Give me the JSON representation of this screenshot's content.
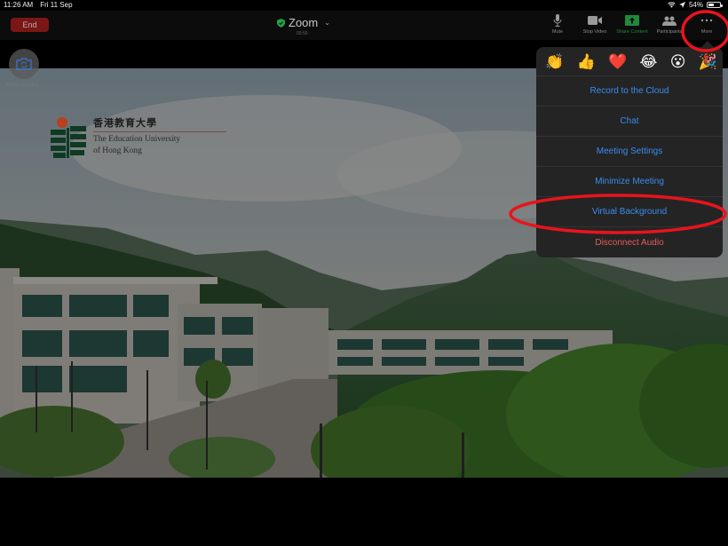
{
  "status_bar": {
    "time": "11:26 AM",
    "date": "Fri 11 Sep",
    "battery_percent_label": "54%",
    "battery_level": 0.54
  },
  "toolbar": {
    "end_label": "End",
    "meeting_name": "Zoom",
    "meeting_timer": "00:50",
    "buttons": [
      {
        "label": "Mute",
        "icon": "microphone-icon"
      },
      {
        "label": "Stop Video",
        "icon": "video-camera-icon"
      },
      {
        "label": "Share Content",
        "icon": "share-screen-icon"
      },
      {
        "label": "Participants",
        "icon": "participants-icon"
      },
      {
        "label": "More",
        "icon": "more-dots-icon"
      }
    ]
  },
  "video": {
    "switch_camera_label": "Switch Camera",
    "logo": {
      "chinese": "香港教育大學",
      "english_line1": "The Education University",
      "english_line2": "of Hong Kong"
    }
  },
  "more_menu": {
    "reactions": [
      "👏",
      "👍",
      "❤️",
      "😂",
      "😮",
      "🎉"
    ],
    "reaction_names": [
      "clap",
      "thumbs-up",
      "heart",
      "joy",
      "open-mouth",
      "tada"
    ],
    "items": [
      {
        "label": "Record to the Cloud",
        "style": "normal"
      },
      {
        "label": "Chat",
        "style": "normal"
      },
      {
        "label": "Meeting Settings",
        "style": "normal"
      },
      {
        "label": "Minimize Meeting",
        "style": "normal"
      },
      {
        "label": "Virtual Background",
        "style": "normal",
        "highlighted": true
      },
      {
        "label": "Disconnect Audio",
        "style": "danger"
      }
    ]
  },
  "colors": {
    "accent_blue": "#3b8cf0",
    "danger_red": "#e85a5a",
    "end_button": "#7a1616",
    "share_green": "#1f8a3a",
    "annotation_red": "#e8141c"
  }
}
